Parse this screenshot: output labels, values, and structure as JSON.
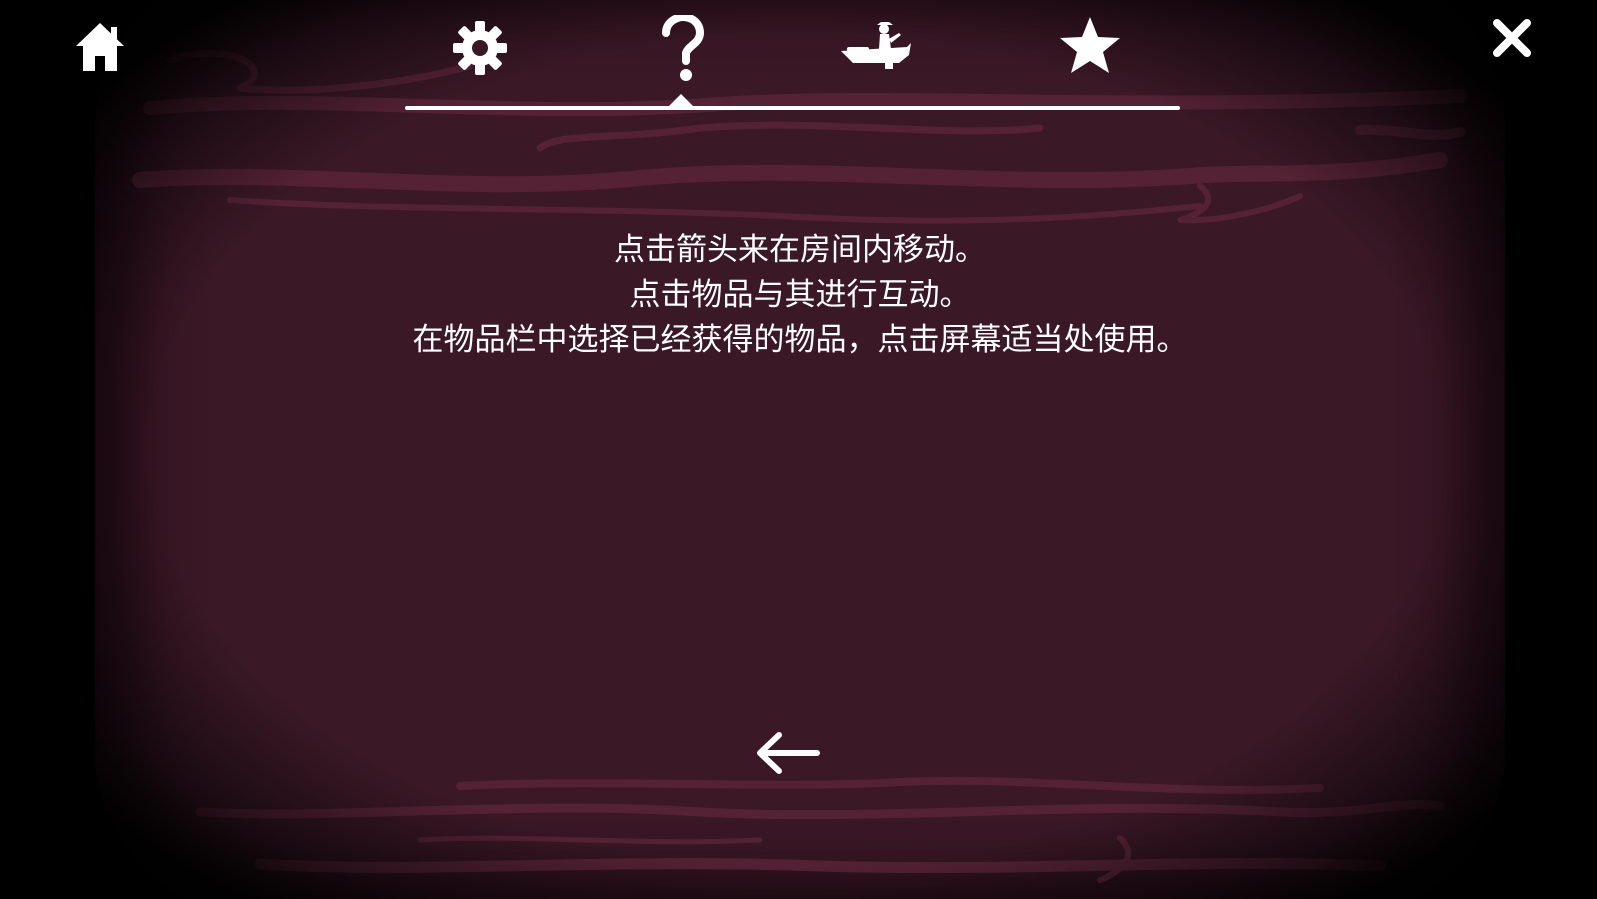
{
  "nav": {
    "home_icon": "home-icon",
    "settings_icon": "gear-icon",
    "help_icon": "question-mark-icon",
    "boat_icon": "boat-icon",
    "star_icon": "star-icon",
    "close_icon": "close-icon",
    "active_tab": "help"
  },
  "help": {
    "lines": [
      "点击箭头来在房间内移动。",
      "点击物品与其进行互动。",
      "在物品栏中选择已经获得的物品，点击屏幕适当处使用。"
    ]
  },
  "back_icon": "arrow-left-icon",
  "colors": {
    "background": "#000000",
    "panel": "#3a1826",
    "streak": "#5a2438",
    "foreground": "#ffffff"
  }
}
